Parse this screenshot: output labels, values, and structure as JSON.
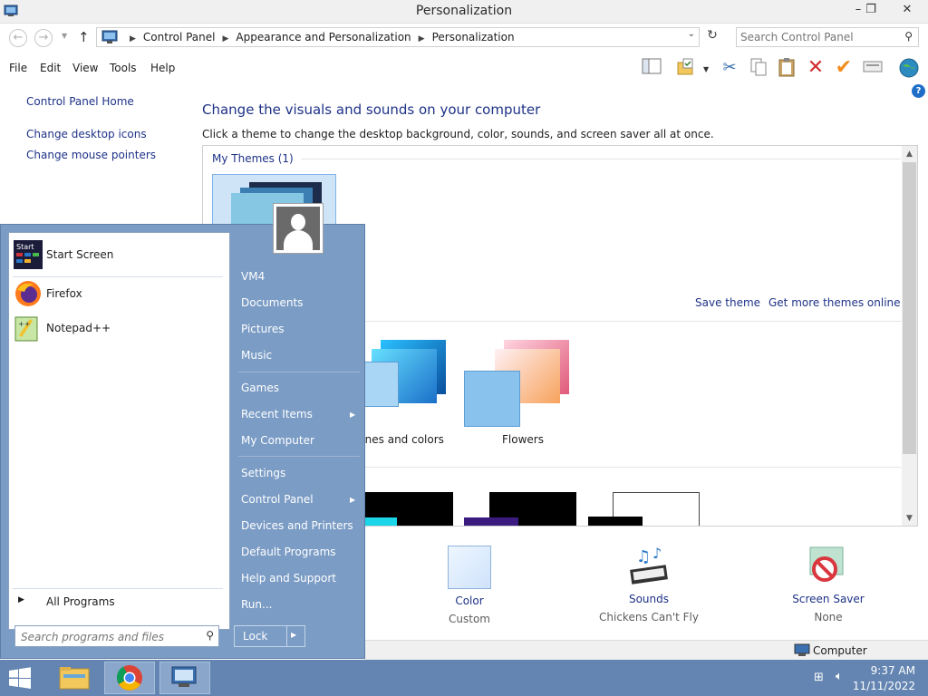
{
  "window": {
    "title": "Personalization",
    "minimize": "–",
    "maximize": "❐",
    "close": "✕"
  },
  "address": {
    "crumbs": [
      "Control Panel",
      "Appearance and Personalization",
      "Personalization"
    ],
    "search_placeholder": "Search Control Panel"
  },
  "menu": [
    "File",
    "Edit",
    "View",
    "Tools",
    "Help"
  ],
  "left_pane": {
    "home": "Control Panel Home",
    "links": [
      "Change desktop icons",
      "Change mouse pointers"
    ]
  },
  "main": {
    "heading": "Change the visuals and sounds on your computer",
    "subtext": "Click a theme to change the desktop background, color, sounds, and screen saver all at once.",
    "my_themes_label": "My Themes (1)",
    "save_theme": "Save theme",
    "get_more_themes": "Get more themes online",
    "theme_labels": [
      "lines and colors",
      "Flowers"
    ]
  },
  "bottom": {
    "color": {
      "label": "Color",
      "value": "Custom"
    },
    "sounds": {
      "label": "Sounds",
      "value": "Chickens Can't Fly"
    },
    "screensaver": {
      "label": "Screen Saver",
      "value": "None"
    }
  },
  "status": {
    "computer": "Computer"
  },
  "start_menu": {
    "programs": [
      {
        "label": "Start Screen",
        "icon": "start-screen-icon"
      },
      {
        "label": "Firefox",
        "icon": "firefox-icon"
      },
      {
        "label": "Notepad++",
        "icon": "notepadpp-icon"
      }
    ],
    "all_programs": "All Programs",
    "search_placeholder": "Search programs and files",
    "places": [
      "VM4",
      "Documents",
      "Pictures",
      "Music",
      "Games",
      "Recent Items",
      "My Computer",
      "Settings",
      "Control Panel",
      "Devices and Printers",
      "Default Programs",
      "Help and Support",
      "Run..."
    ],
    "lock": "Lock"
  },
  "taskbar": {
    "time": "9:37 AM",
    "date": "11/11/2022"
  },
  "colors": {
    "link": "#1e3287",
    "start_menu": "#7b9cc5",
    "taskbar": "#6485b1"
  }
}
